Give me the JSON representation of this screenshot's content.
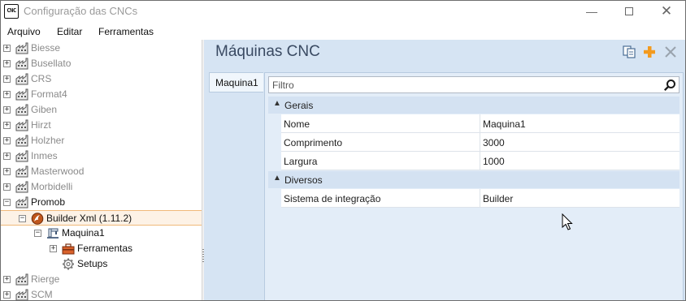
{
  "window": {
    "app_icon_text": "CNC",
    "title": "Configuração das CNCs",
    "controls": {
      "minimize": "—",
      "maximize": "",
      "close": "✕"
    }
  },
  "menu": {
    "items": [
      {
        "label": "Arquivo"
      },
      {
        "label": "Editar"
      },
      {
        "label": "Ferramentas"
      }
    ]
  },
  "tree": {
    "nodes": [
      {
        "label": "Biesse",
        "level": 0,
        "expander": "+",
        "icon": "factory-icon",
        "dim": true
      },
      {
        "label": "Busellato",
        "level": 0,
        "expander": "+",
        "icon": "factory-icon",
        "dim": true
      },
      {
        "label": "CRS",
        "level": 0,
        "expander": "+",
        "icon": "factory-icon",
        "dim": true
      },
      {
        "label": "Format4",
        "level": 0,
        "expander": "+",
        "icon": "factory-icon",
        "dim": true
      },
      {
        "label": "Giben",
        "level": 0,
        "expander": "+",
        "icon": "factory-icon",
        "dim": true
      },
      {
        "label": "Hirzt",
        "level": 0,
        "expander": "+",
        "icon": "factory-icon",
        "dim": true
      },
      {
        "label": "Holzher",
        "level": 0,
        "expander": "+",
        "icon": "factory-icon",
        "dim": true
      },
      {
        "label": "Inmes",
        "level": 0,
        "expander": "+",
        "icon": "factory-icon",
        "dim": true
      },
      {
        "label": "Masterwood",
        "level": 0,
        "expander": "+",
        "icon": "factory-icon",
        "dim": true
      },
      {
        "label": "Morbidelli",
        "level": 0,
        "expander": "+",
        "icon": "factory-icon",
        "dim": true
      },
      {
        "label": "Promob",
        "level": 0,
        "expander": "−",
        "icon": "factory-icon",
        "dim": false
      },
      {
        "label": "Builder Xml (1.11.2)",
        "level": 1,
        "expander": "−",
        "icon": "builder-logo-icon",
        "dim": false,
        "selected": true
      },
      {
        "label": "Maquina1",
        "level": 2,
        "expander": "−",
        "icon": "machine-icon",
        "dim": false
      },
      {
        "label": "Ferramentas",
        "level": 3,
        "expander": "+",
        "icon": "toolbox-icon",
        "dim": false
      },
      {
        "label": "Setups",
        "level": 3,
        "expander": "",
        "icon": "gear-icon",
        "dim": false
      },
      {
        "label": "Rierge",
        "level": 0,
        "expander": "+",
        "icon": "factory-icon",
        "dim": true
      },
      {
        "label": "SCM",
        "level": 0,
        "expander": "+",
        "icon": "factory-icon",
        "dim": true
      }
    ]
  },
  "panel": {
    "title": "Máquinas CNC",
    "tab_label": "Maquina1",
    "filter_placeholder": "Filtro",
    "categories": [
      {
        "label": "Gerais",
        "arrow": "▲",
        "properties": [
          {
            "name": "Nome",
            "value": "Maquina1"
          },
          {
            "name": "Comprimento",
            "value": "3000"
          },
          {
            "name": "Largura",
            "value": "1000"
          }
        ]
      },
      {
        "label": "Diversos",
        "arrow": "▲",
        "properties": [
          {
            "name": "Sistema de integração",
            "value": "Builder"
          }
        ]
      }
    ]
  },
  "colors": {
    "accent_orange": "#f39a1e",
    "panel_background": "#d6e4f3",
    "selected_row_border": "#f0b97a",
    "title_text": "#3a4a62"
  }
}
